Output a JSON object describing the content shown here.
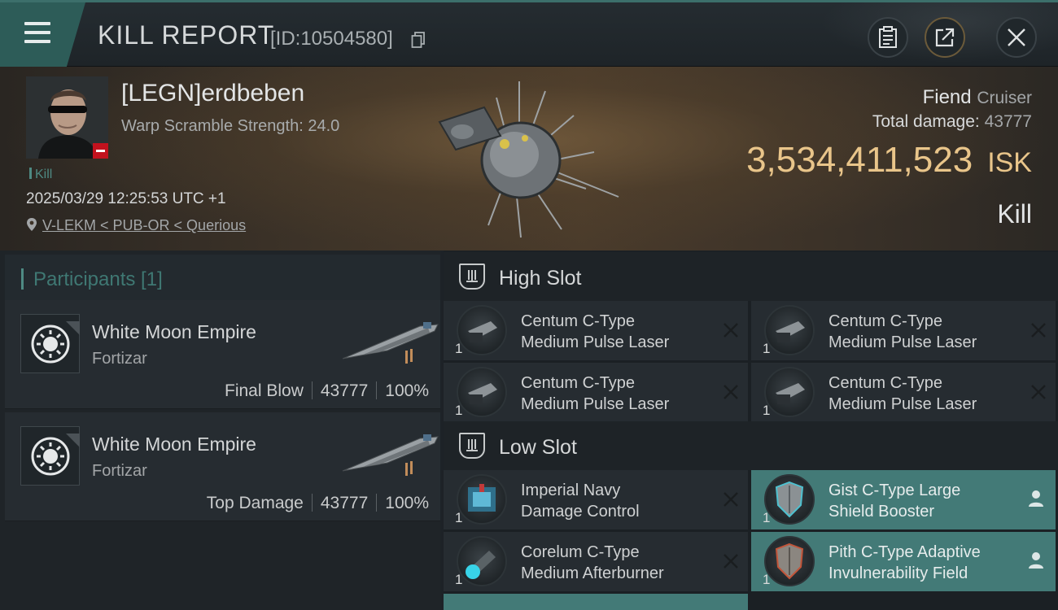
{
  "header": {
    "title": "KILL REPORT",
    "report_id": "[ID:10504580]"
  },
  "victim": {
    "pilot_name": "[LEGN]erdbeben",
    "warp_scramble": "Warp Scramble Strength: 24.0",
    "kill_tag": "Kill",
    "datetime": "2025/03/29 12:25:53 UTC +1",
    "location": "V-LEKM < PUB-OR < Querious",
    "ship_name": "Fiend",
    "ship_class": "Cruiser",
    "total_damage_label": "Total damage:",
    "total_damage_value": "43777",
    "isk_value": "3,534,411,523",
    "isk_unit": "ISK",
    "result": "Kill"
  },
  "participants": {
    "header": "Participants [1]",
    "cards": [
      {
        "corp": "White Moon Empire",
        "ship": "Fortizar",
        "role": "Final Blow",
        "damage": "43777",
        "percent": "100%"
      },
      {
        "corp": "White Moon Empire",
        "ship": "Fortizar",
        "role": "Top Damage",
        "damage": "43777",
        "percent": "100%"
      }
    ]
  },
  "fittings": {
    "high_slot": {
      "title": "High Slot",
      "items": [
        {
          "line1": "Centum C-Type",
          "line2": "Medium Pulse Laser",
          "qty": "1",
          "status": "destroyed",
          "icon": "pulse-laser-icon"
        },
        {
          "line1": "Centum C-Type",
          "line2": "Medium Pulse Laser",
          "qty": "1",
          "status": "destroyed",
          "icon": "pulse-laser-icon"
        },
        {
          "line1": "Centum C-Type",
          "line2": "Medium Pulse Laser",
          "qty": "1",
          "status": "destroyed",
          "icon": "pulse-laser-icon"
        },
        {
          "line1": "Centum C-Type",
          "line2": "Medium Pulse Laser",
          "qty": "1",
          "status": "destroyed",
          "icon": "pulse-laser-icon"
        }
      ]
    },
    "low_slot": {
      "title": "Low Slot",
      "items": [
        {
          "line1": "Imperial Navy",
          "line2": "Damage Control",
          "qty": "1",
          "status": "destroyed",
          "icon": "damage-control-icon"
        },
        {
          "line1": "Gist C-Type Large",
          "line2": "Shield Booster",
          "qty": "1",
          "status": "dropped",
          "icon": "shield-booster-icon"
        },
        {
          "line1": "Corelum C-Type",
          "line2": "Medium Afterburner",
          "qty": "1",
          "status": "destroyed",
          "icon": "afterburner-icon"
        },
        {
          "line1": "Pith C-Type Adaptive",
          "line2": "Invulnerability Field",
          "qty": "1",
          "status": "dropped",
          "icon": "invulnerability-field-icon"
        }
      ]
    }
  },
  "colors": {
    "accent_teal": "#437a77",
    "isk_gold": "#e9c58a",
    "badge_red": "#c2121e"
  }
}
